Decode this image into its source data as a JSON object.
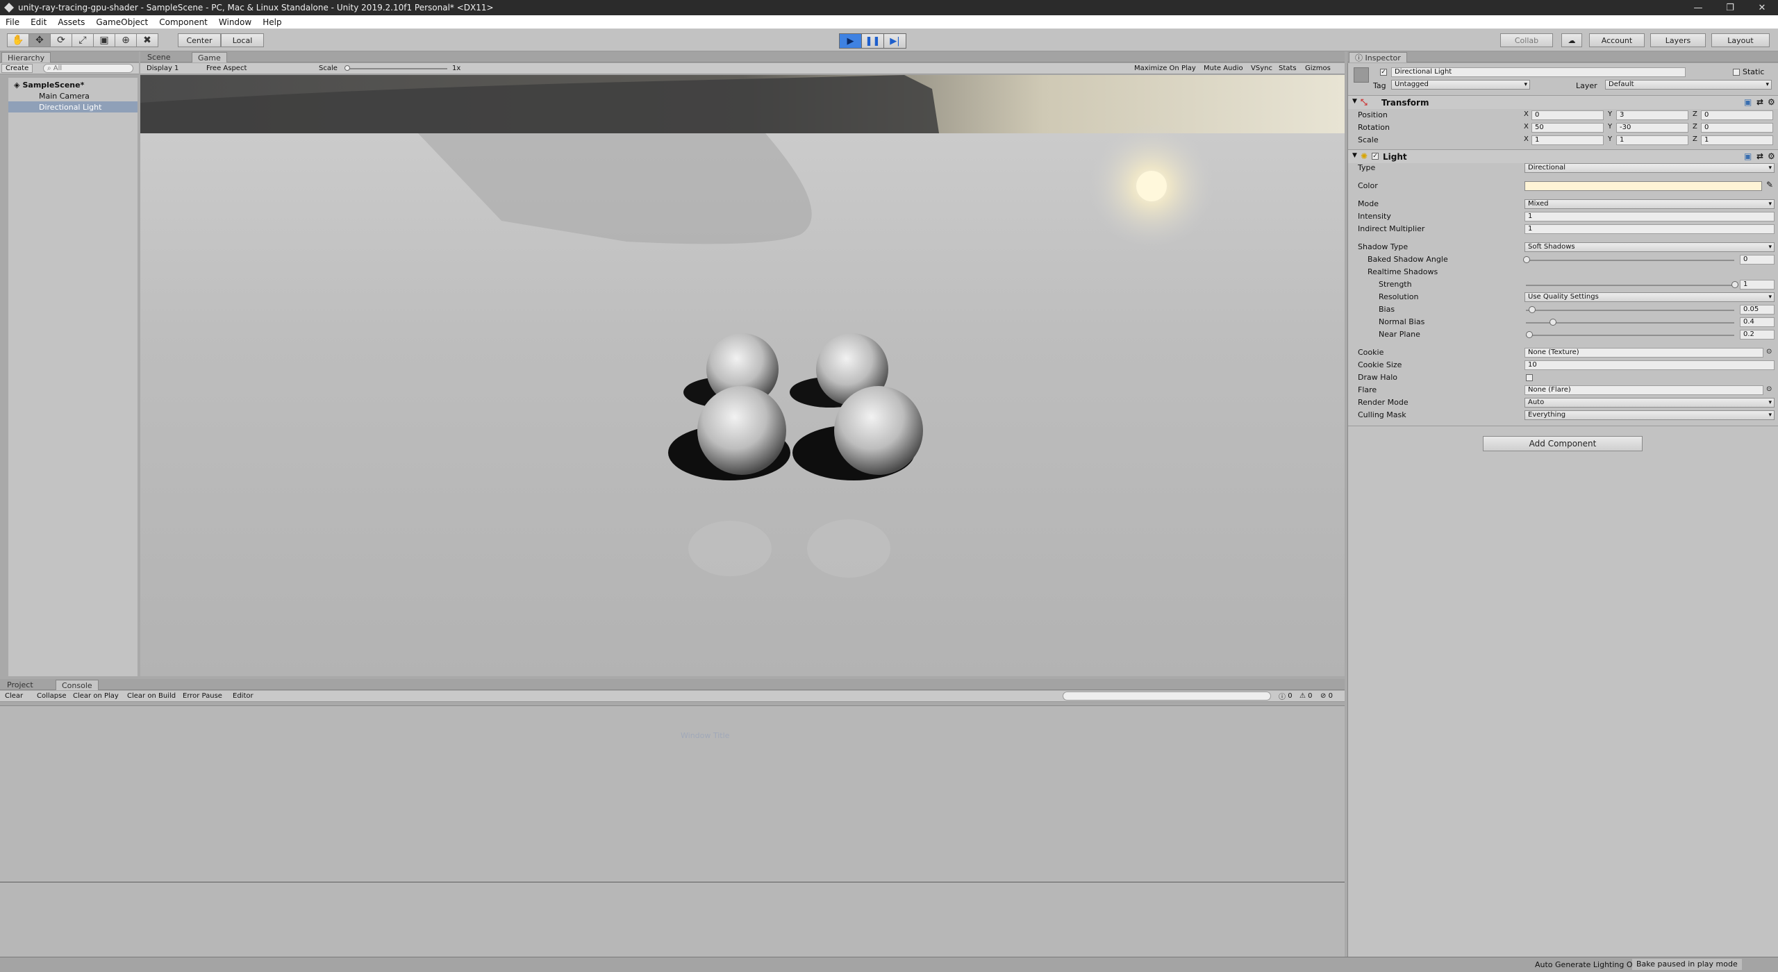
{
  "window": {
    "title": "unity-ray-tracing-gpu-shader - SampleScene - PC, Mac & Linux Standalone - Unity 2019.2.10f1 Personal* <DX11>",
    "controls": [
      "—",
      "❐",
      "✕"
    ]
  },
  "menu": [
    "File",
    "Edit",
    "Assets",
    "GameObject",
    "Component",
    "Window",
    "Help"
  ],
  "toolbar": {
    "tools": [
      "✋",
      "✥",
      "⟳",
      "⤢",
      "▣",
      "⊕",
      "✖"
    ],
    "pivot": "Center",
    "space": "Local",
    "play_icons": [
      "▶",
      "❚❚",
      "▶|"
    ],
    "collab": "Collab",
    "account": "Account",
    "layers": "Layers",
    "layout": "Layout"
  },
  "hierarchy": {
    "tab": "Hierarchy",
    "create": "Create",
    "search_placeholder": "All",
    "scene": "SampleScene*",
    "items": [
      "Main Camera",
      "Directional Light"
    ]
  },
  "view_tabs": {
    "scene": "Scene",
    "game": "Game"
  },
  "game_bar": {
    "display": "Display 1",
    "aspect": "Free Aspect",
    "scale_label": "Scale",
    "scale_value": "1x",
    "toggles": [
      "Maximize On Play",
      "Mute Audio",
      "VSync",
      "Stats",
      "Gizmos"
    ]
  },
  "console": {
    "tabs": [
      "Project",
      "Console"
    ],
    "buttons": [
      "Clear",
      "Collapse",
      "Clear on Play",
      "Clear on Build",
      "Error Pause",
      "Editor"
    ],
    "counts": [
      "0",
      "0",
      "0"
    ],
    "faint_text": "Window Title"
  },
  "inspector": {
    "tab": "Inspector",
    "object_name": "Directional Light",
    "static_label": "Static",
    "tag_label": "Tag",
    "tag_value": "Untagged",
    "layer_label": "Layer",
    "layer_value": "Default",
    "transform": {
      "title": "Transform",
      "rows": [
        {
          "label": "Position",
          "x": "0",
          "y": "3",
          "z": "0"
        },
        {
          "label": "Rotation",
          "x": "50",
          "y": "-30",
          "z": "0"
        },
        {
          "label": "Scale",
          "x": "1",
          "y": "1",
          "z": "1"
        }
      ]
    },
    "light": {
      "title": "Light",
      "type_label": "Type",
      "type_value": "Directional",
      "color_label": "Color",
      "color_value": "#fff4d6",
      "mode_label": "Mode",
      "mode_value": "Mixed",
      "intensity_label": "Intensity",
      "intensity_value": "1",
      "indirect_label": "Indirect Multiplier",
      "indirect_value": "1",
      "shadow_type_label": "Shadow Type",
      "shadow_type_value": "Soft Shadows",
      "baked_angle_label": "Baked Shadow Angle",
      "baked_angle_value": "0",
      "realtime_label": "Realtime Shadows",
      "strength_label": "Strength",
      "strength_value": "1",
      "resolution_label": "Resolution",
      "resolution_value": "Use Quality Settings",
      "bias_label": "Bias",
      "bias_value": "0.05",
      "normal_bias_label": "Normal Bias",
      "normal_bias_value": "0.4",
      "near_plane_label": "Near Plane",
      "near_plane_value": "0.2",
      "cookie_label": "Cookie",
      "cookie_value": "None (Texture)",
      "cookie_size_label": "Cookie Size",
      "cookie_size_value": "10",
      "draw_halo_label": "Draw Halo",
      "flare_label": "Flare",
      "flare_value": "None (Flare)",
      "render_mode_label": "Render Mode",
      "render_mode_value": "Auto",
      "culling_label": "Culling Mask",
      "culling_value": "Everything"
    },
    "add_component": "Add Component"
  },
  "status": {
    "auto_lighting": "Auto Generate Lighting On",
    "bake": "Bake paused in play mode"
  }
}
